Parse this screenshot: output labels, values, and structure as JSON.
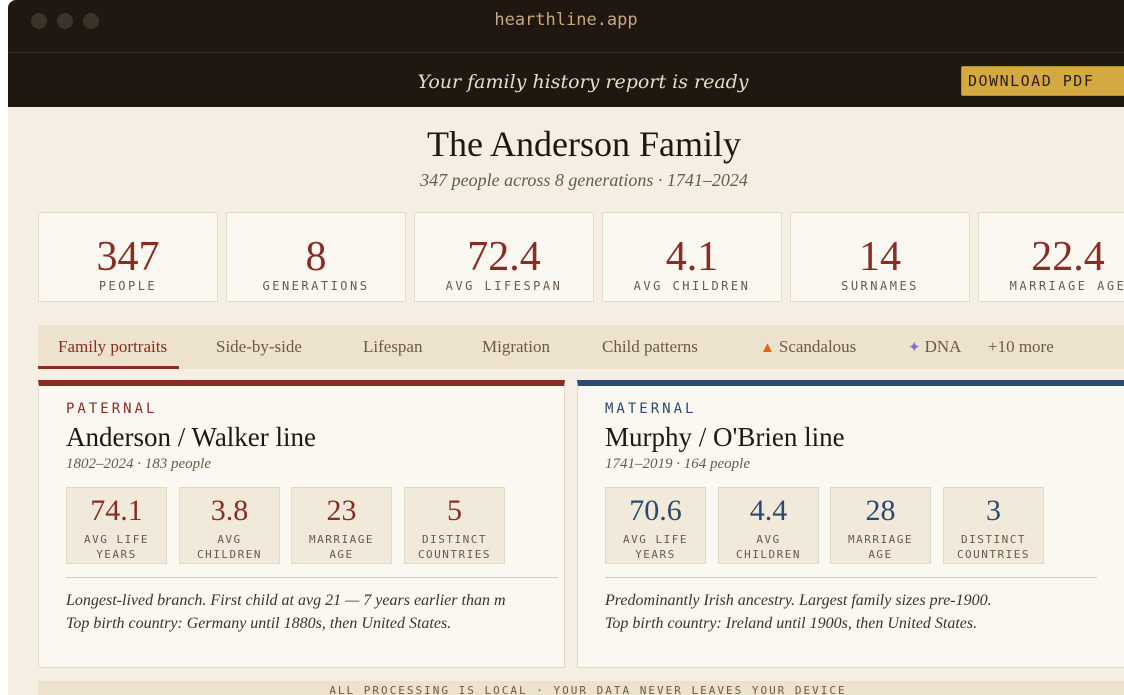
{
  "browser": {
    "url": "hearthline.app"
  },
  "banner": {
    "message": "Your family history report is ready",
    "download_label": "DOWNLOAD PDF"
  },
  "header": {
    "title": "The Anderson Family",
    "subtitle": "347 people across 8 generations · 1741–2024"
  },
  "stats": [
    {
      "value": "347",
      "label": "PEOPLE"
    },
    {
      "value": "8",
      "label": "GENERATIONS"
    },
    {
      "value": "72.4",
      "label": "AVG LIFESPAN"
    },
    {
      "value": "4.1",
      "label": "AVG CHILDREN"
    },
    {
      "value": "14",
      "label": "SURNAMES"
    },
    {
      "value": "22.4",
      "label": "MARRIAGE AGE"
    }
  ],
  "tabs": [
    {
      "label": "Family portraits",
      "active": true
    },
    {
      "label": "Side-by-side"
    },
    {
      "label": "Lifespan"
    },
    {
      "label": "Migration"
    },
    {
      "label": "Child patterns"
    },
    {
      "label": "Scandalous",
      "icon": "fire-icon"
    },
    {
      "label": "DNA",
      "icon": "dna-icon"
    },
    {
      "label": "+10 more"
    }
  ],
  "paternal": {
    "kicker": "PATERNAL",
    "title": "Anderson / Walker line",
    "subtitle": "1802–2024 · 183 people",
    "stats": [
      {
        "value": "74.1",
        "label_1": "AVG LIFE",
        "label_2": "YEARS"
      },
      {
        "value": "3.8",
        "label_1": "AVG",
        "label_2": "CHILDREN"
      },
      {
        "value": "23",
        "label_1": "MARRIAGE",
        "label_2": "AGE"
      },
      {
        "value": "5",
        "label_1": "DISTINCT",
        "label_2": "COUNTRIES"
      }
    ],
    "note_1": "Longest-lived branch. First child at avg 21 — 7 years earlier than m",
    "note_2": "Top birth country: Germany until 1880s, then United States."
  },
  "maternal": {
    "kicker": "MATERNAL",
    "title": "Murphy / O'Brien line",
    "subtitle": "1741–2019 · 164 people",
    "stats": [
      {
        "value": "70.6",
        "label_1": "AVG LIFE",
        "label_2": "YEARS"
      },
      {
        "value": "4.4",
        "label_1": "AVG",
        "label_2": "CHILDREN"
      },
      {
        "value": "28",
        "label_1": "MARRIAGE",
        "label_2": "AGE"
      },
      {
        "value": "3",
        "label_1": "DISTINCT",
        "label_2": "COUNTRIES"
      }
    ],
    "note_1": "Predominantly Irish ancestry. Largest family sizes pre-1900.",
    "note_2": "Top birth country: Ireland until 1900s, then United States."
  },
  "footer": {
    "text": "ALL PROCESSING IS LOCAL · YOUR DATA NEVER LEAVES YOUR DEVICE"
  },
  "colors": {
    "accent_paternal": "#8b2c24",
    "accent_maternal": "#2c4a70",
    "download_button": "#d4a942",
    "titlebar": "#1f1710"
  }
}
